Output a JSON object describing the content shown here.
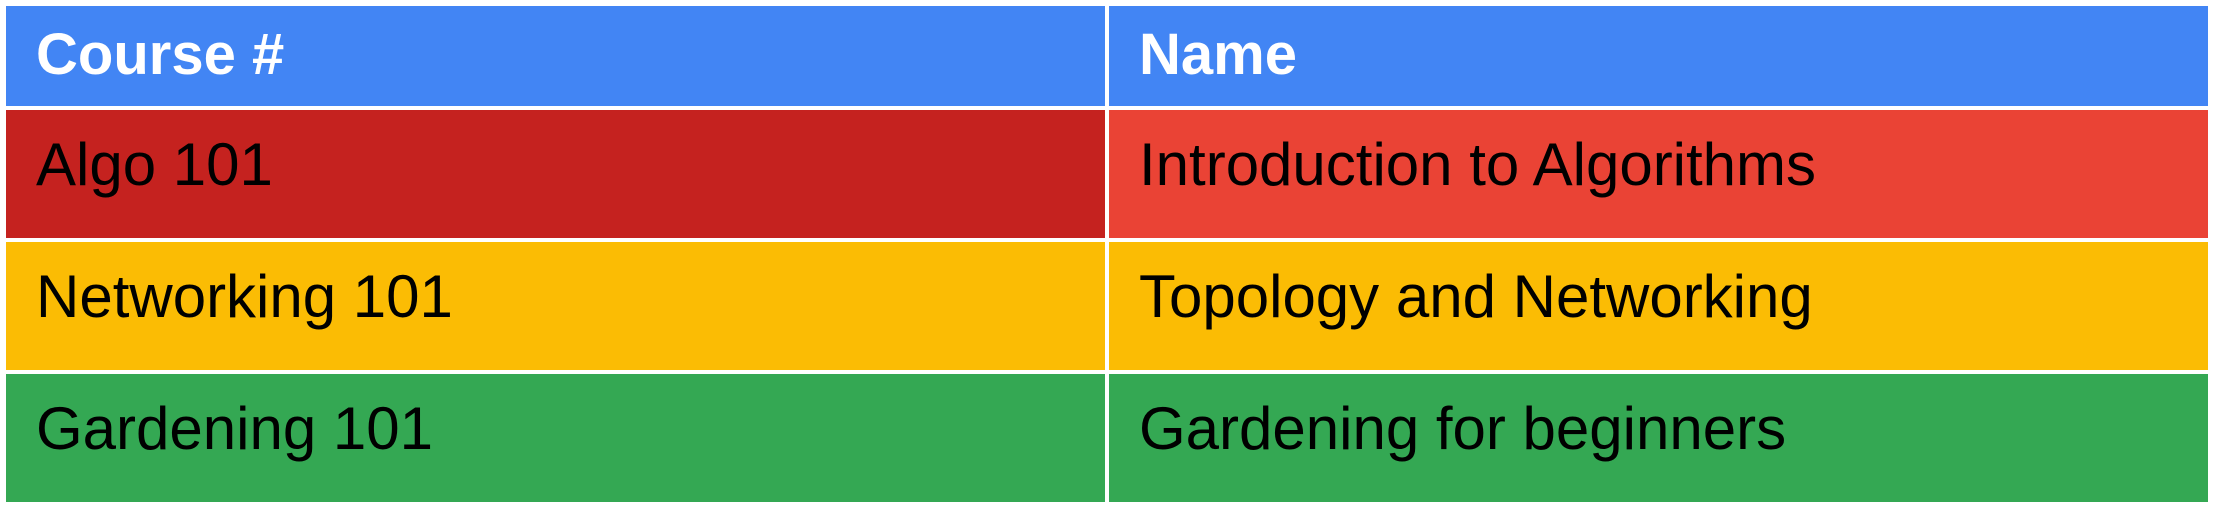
{
  "colors": {
    "header": "#4285f4",
    "row_1_left": "#c5221f",
    "row_1_right": "#ea4335",
    "row_2": "#fbbc04",
    "row_3": "#34a853",
    "text_header": "#ffffff",
    "text_body": "#000000"
  },
  "table": {
    "headers": [
      "Course #",
      "Name"
    ],
    "rows": [
      [
        "Algo 101",
        "Introduction to Algorithms"
      ],
      [
        "Networking 101",
        "Topology and Networking"
      ],
      [
        "Gardening 101",
        "Gardening for beginners"
      ]
    ]
  }
}
